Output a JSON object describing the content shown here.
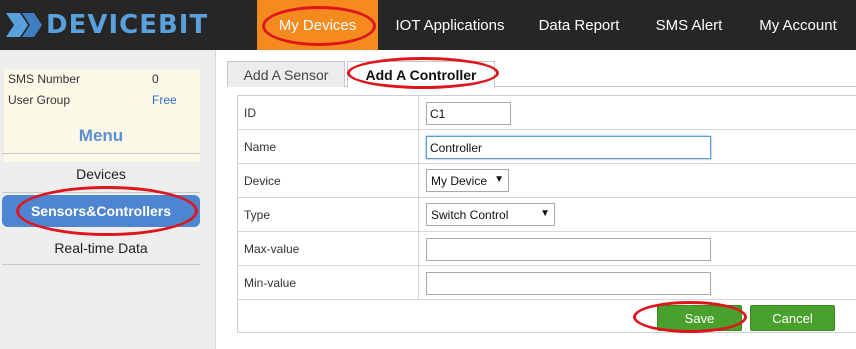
{
  "brand": {
    "name": "DEVICEBIT"
  },
  "nav": {
    "items": [
      {
        "label": "My Devices"
      },
      {
        "label": "IOT Applications"
      },
      {
        "label": "Data Report"
      },
      {
        "label": "SMS Alert"
      },
      {
        "label": "My Account"
      }
    ],
    "active_color": "#f58a1f"
  },
  "sidebar": {
    "info": [
      {
        "label": "SMS Number",
        "value": "0"
      },
      {
        "label": "User Group",
        "value": "Free"
      }
    ],
    "menu_title": "Menu",
    "items": [
      {
        "label": "Devices"
      },
      {
        "label": "Sensors&Controllers"
      },
      {
        "label": "Real-time Data"
      }
    ]
  },
  "tabs": [
    {
      "label": "Add A Sensor"
    },
    {
      "label": "Add A Controller"
    }
  ],
  "form": {
    "fields": [
      {
        "label": "ID",
        "value": "C1"
      },
      {
        "label": "Name",
        "value": "Controller"
      },
      {
        "label": "Device",
        "value": "My Device"
      },
      {
        "label": "Type",
        "value": "Switch Control"
      },
      {
        "label": "Max-value",
        "value": ""
      },
      {
        "label": "Min-value",
        "value": ""
      }
    ],
    "save_label": "Save",
    "cancel_label": "Cancel"
  },
  "colors": {
    "accent": "#4d85d1",
    "button": "#4aa02c",
    "annotation": "#e0141b"
  }
}
